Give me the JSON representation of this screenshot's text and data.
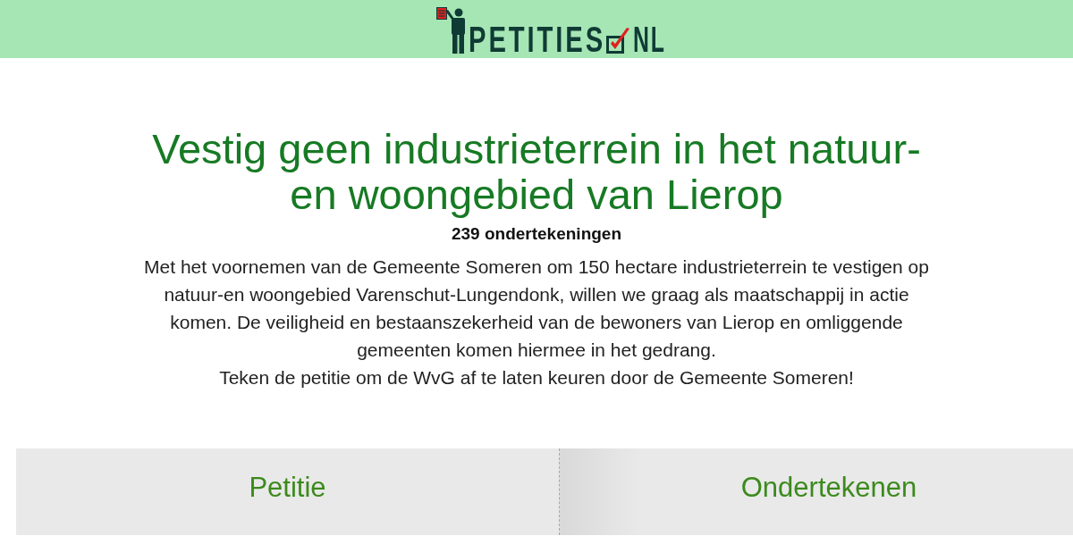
{
  "header": {
    "logo": {
      "name": "PETITIES",
      "suffix": "NL"
    }
  },
  "petition": {
    "title": "Vestig geen industrieterrein in het natuur- en woongebied van Lierop",
    "signature_count": "239 ondertekeningen",
    "description": "Met het voornemen van de Gemeente Someren om 150 hectare industrieterrein te vestigen op natuur-en woongebied Varenschut-Lungendonk, willen we graag als maatschappij in actie komen. De veiligheid en bestaanszekerheid van de bewoners van Lierop en omliggende gemeenten komen hiermee in het gedrang.",
    "call_to_action": "Teken de petitie om de WvG af te laten keuren door de Gemeente Someren!"
  },
  "panels": [
    {
      "heading": "Petitie"
    },
    {
      "heading": "Ondertekenen"
    }
  ]
}
